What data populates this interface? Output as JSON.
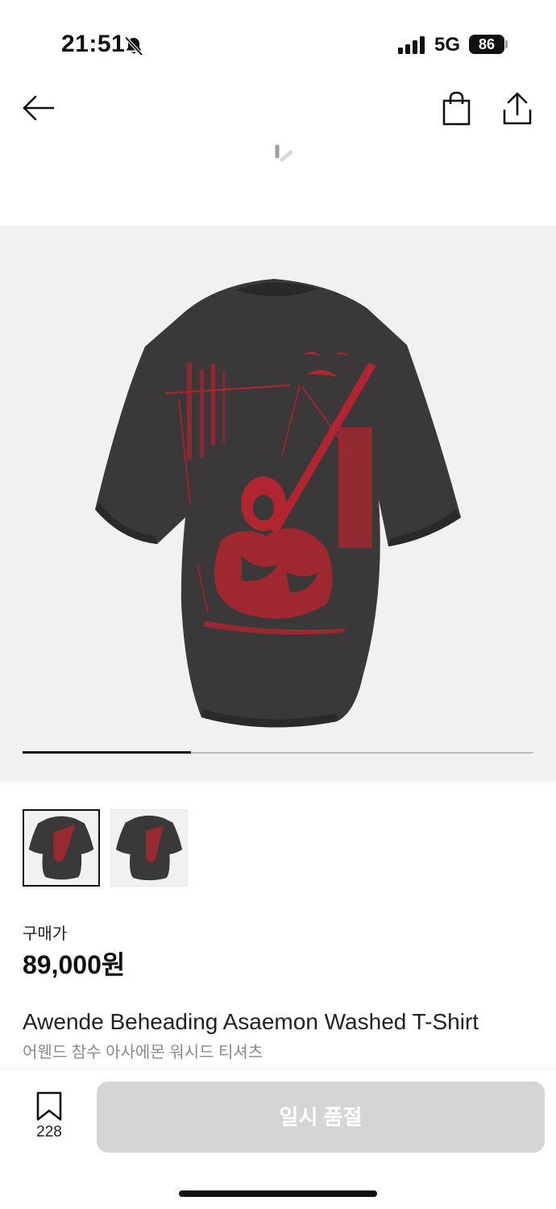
{
  "status_bar": {
    "time": "21:51",
    "network": "5G",
    "battery": "86"
  },
  "nav": {
    "back_icon": "arrow-left-icon",
    "bag_icon": "shopping-bag-icon",
    "share_icon": "share-icon"
  },
  "gallery": {
    "image_count": 2,
    "current_index": 1,
    "progress_fraction": 0.33
  },
  "price": {
    "label": "구매가",
    "value": "89,000원"
  },
  "product": {
    "name_en": "Awende Beheading Asaemon Washed T-Shirt",
    "name_kr": "어웬드 참수 아사에몬 워시드 티셔츠"
  },
  "bottom_bar": {
    "bookmark_count": "228",
    "action_label": "일시 품절"
  },
  "colors": {
    "accent": "#111111",
    "disabled_button": "#d5d5d5",
    "image_bg": "#f1f1f1",
    "print_red": "#b0252f"
  }
}
